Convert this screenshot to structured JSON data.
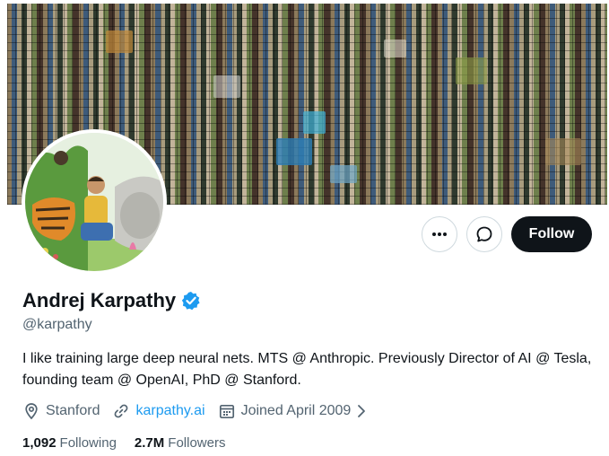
{
  "profile": {
    "name": "Andrej Karpathy",
    "handle": "@karpathy",
    "bio": "I like training large deep neural nets. MTS @ Anthropic. Previously Director of AI @ Tesla, founding team @ OpenAI, PhD @ Stanford.",
    "location": "Stanford",
    "website": "karpathy.ai",
    "joined": "Joined April 2009",
    "verified": true
  },
  "actions": {
    "more_icon": "more-dots-icon",
    "message_icon": "message-bubble-icon",
    "follow_label": "Follow"
  },
  "stats": {
    "following_count": "1,092",
    "following_label": "Following",
    "followers_count": "2.7M",
    "followers_label": "Followers"
  },
  "colors": {
    "accent": "#1d9bf0",
    "text_primary": "#0f1419",
    "text_secondary": "#536471",
    "follow_bg": "#0f1419"
  }
}
